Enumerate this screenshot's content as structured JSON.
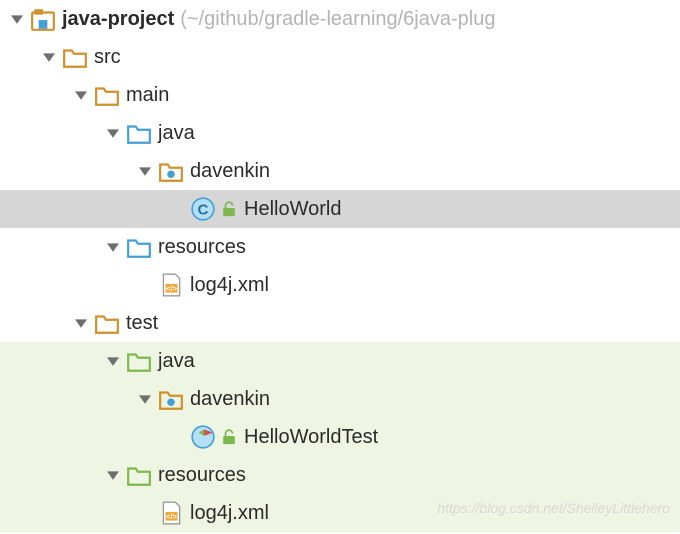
{
  "tree": {
    "root": {
      "name": "java-project",
      "path_hint": "(~/github/gradle-learning/6java-plug",
      "children": [
        {
          "name": "src",
          "type": "folder-orange",
          "children": [
            {
              "name": "main",
              "type": "folder-orange",
              "children": [
                {
                  "name": "java",
                  "type": "folder-blue",
                  "children": [
                    {
                      "name": "davenkin",
                      "type": "package",
                      "children": [
                        {
                          "name": "HelloWorld",
                          "type": "class-file"
                        }
                      ]
                    }
                  ]
                },
                {
                  "name": "resources",
                  "type": "folder-blue",
                  "children": [
                    {
                      "name": "log4j.xml",
                      "type": "xml-file"
                    }
                  ]
                }
              ]
            },
            {
              "name": "test",
              "type": "folder-orange",
              "children": [
                {
                  "name": "java",
                  "type": "folder-green",
                  "children": [
                    {
                      "name": "davenkin",
                      "type": "package",
                      "children": [
                        {
                          "name": "HelloWorldTest",
                          "type": "test-class-file"
                        }
                      ]
                    }
                  ]
                },
                {
                  "name": "resources",
                  "type": "folder-green",
                  "children": [
                    {
                      "name": "log4j.xml",
                      "type": "xml-file"
                    }
                  ]
                }
              ]
            }
          ]
        }
      ]
    }
  },
  "watermark": "https://blog.csdn.net/ShelleyLittlehero"
}
